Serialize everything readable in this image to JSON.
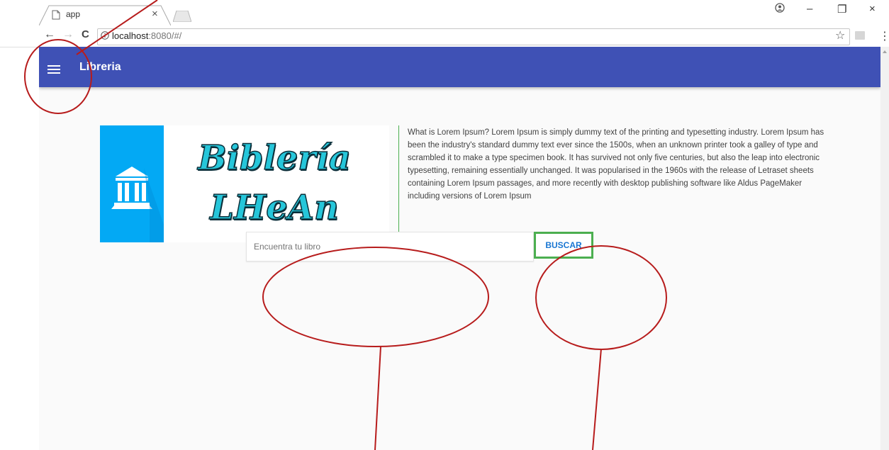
{
  "browser": {
    "tab_title": "app",
    "tab_close": "×",
    "url_host": "localhost",
    "url_rest": ":8080/#/",
    "star_glyph": "☆",
    "menu_glyph": "⋮",
    "back_glyph": "←",
    "forward_glyph": "→",
    "reload_glyph": "C",
    "window_controls": {
      "account": "👤",
      "minimize": "–",
      "restore": "❐",
      "close": "×"
    }
  },
  "appbar": {
    "title": "Libreria",
    "color": "#3f51b5",
    "menu_icon": "hamburger-icon"
  },
  "logo": {
    "line1": "Biblería",
    "line2": "LHeAn",
    "icon": "bank-building-icon"
  },
  "description": "What is Lorem Ipsum? Lorem Ipsum is simply dummy text of the printing and typesetting industry. Lorem Ipsum has been the industry's standard dummy text ever since the 1500s, when an unknown printer took a galley of type and scrambled it to make a type specimen book. It has survived not only five centuries, but also the leap into electronic typesetting, remaining essentially unchanged. It was popularised in the 1960s with the release of Letraset sheets containing Lorem Ipsum passages, and more recently with desktop publishing software like Aldus PageMaker including versions of Lorem Ipsum",
  "search": {
    "placeholder": "Encuentra tu libro",
    "value": "",
    "button_label": "BUSCAR"
  },
  "colors": {
    "accent_green": "#4caf50",
    "annotation_red": "#b71c1c",
    "logo_blue": "#03a9f4",
    "button_text": "#1976d2"
  }
}
